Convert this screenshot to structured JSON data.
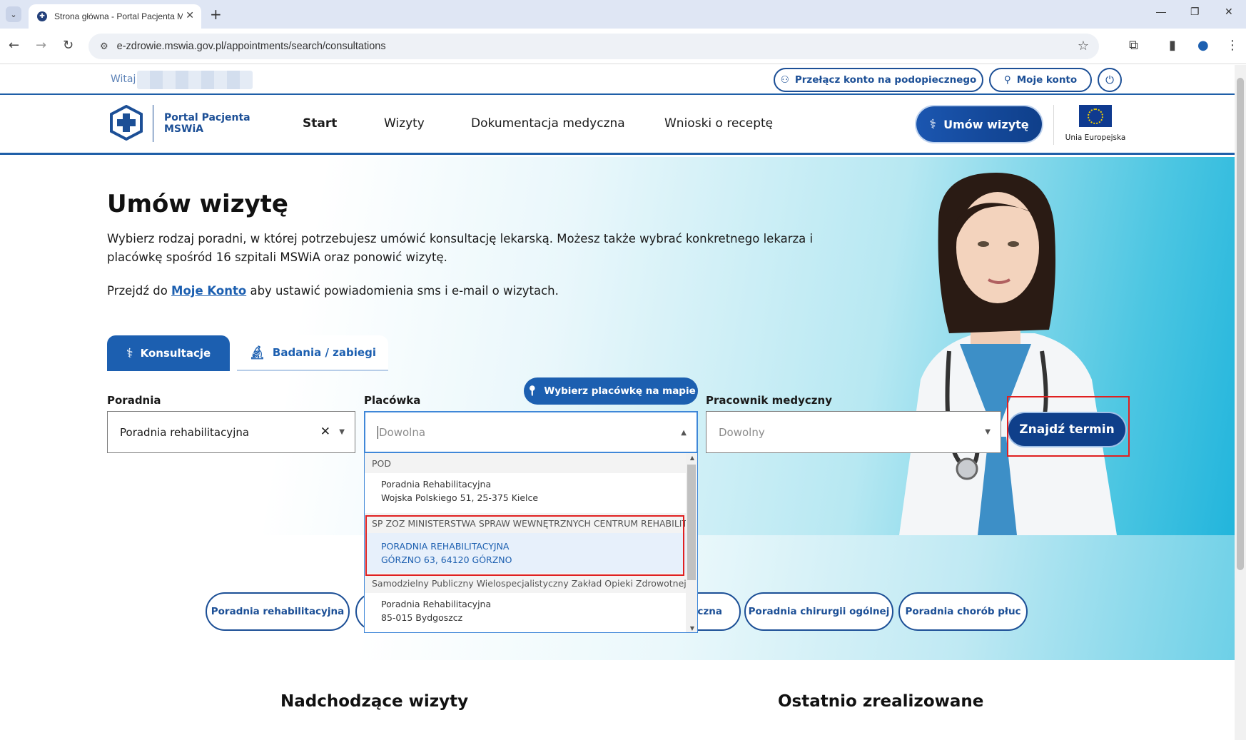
{
  "browser": {
    "tab_title": "Strona główna - Portal Pacjenta M",
    "url": "e-zdrowie.mswia.gov.pl/appointments/search/consultations"
  },
  "utility": {
    "greeting": "Witaj",
    "switch_account": "Przełącz konto na podopiecznego",
    "my_account": "Moje konto"
  },
  "header": {
    "logo_line1": "Portal Pacjenta",
    "logo_line2": "MSWiA",
    "nav": [
      "Start",
      "Wizyty",
      "Dokumentacja medyczna",
      "Wnioski o receptę"
    ],
    "cta": "Umów wizytę",
    "eu_label": "Unia Europejska"
  },
  "hero": {
    "title": "Umów wizytę",
    "description": "Wybierz rodzaj poradni, w której potrzebujesz umówić konsultację lekarską. Możesz także wybrać konkretnego lekarza i placówkę spośród 16 szpitali MSWiA oraz ponowić wizytę.",
    "note_prefix": "Przejdź do",
    "note_link": "Moje Konto",
    "note_suffix": "aby ustawić powiadomienia sms i e-mail o wizytach."
  },
  "tabs": {
    "consultations": "Konsultacje",
    "exams": "Badania / zabiegi"
  },
  "form": {
    "clinic_label": "Poradnia",
    "clinic_value": "Poradnia rehabilitacyjna",
    "facility_label": "Placówka",
    "facility_placeholder": "Dowolna",
    "map_button": "Wybierz placówkę na mapie",
    "staff_label": "Pracownik medyczny",
    "staff_placeholder": "Dowolny",
    "find_button": "Znajdź termin"
  },
  "dropdown": {
    "group1": "POD",
    "option1_line1": "Poradnia Rehabilitacyjna",
    "option1_line2": "Wojska Polskiego 51, 25-375 Kielce",
    "group2": "SP ZOZ MINISTERSTWA SPRAW WEWNĘTRZNYCH CENTRUM REHABILIT...",
    "option2_line1": "PORADNIA REHABILITACYJNA",
    "option2_line2": "GÓRZNO 63, 64120 GÓRZNO",
    "group3": "Samodzielny Publiczny Wielospecjalistyczny Zakład Opieki Zdrowotnej...",
    "option3_line1": "Poradnia Rehabilitacyjna",
    "option3_line2": "85-015 Bydgoszcz"
  },
  "chips": {
    "chip1": "Poradnia rehabilitacyjna",
    "chip2_partial": "giczna",
    "chip3": "Poradnia chirurgii ogólnej",
    "chip4": "Poradnia chorób płuc"
  },
  "sections": {
    "upcoming": "Nadchodzące wizyty",
    "recent": "Ostatnio zrealizowane"
  },
  "colors": {
    "brand_blue": "#1c5fb0",
    "dark_blue": "#0f3f8a",
    "highlight_red": "#e02020"
  }
}
